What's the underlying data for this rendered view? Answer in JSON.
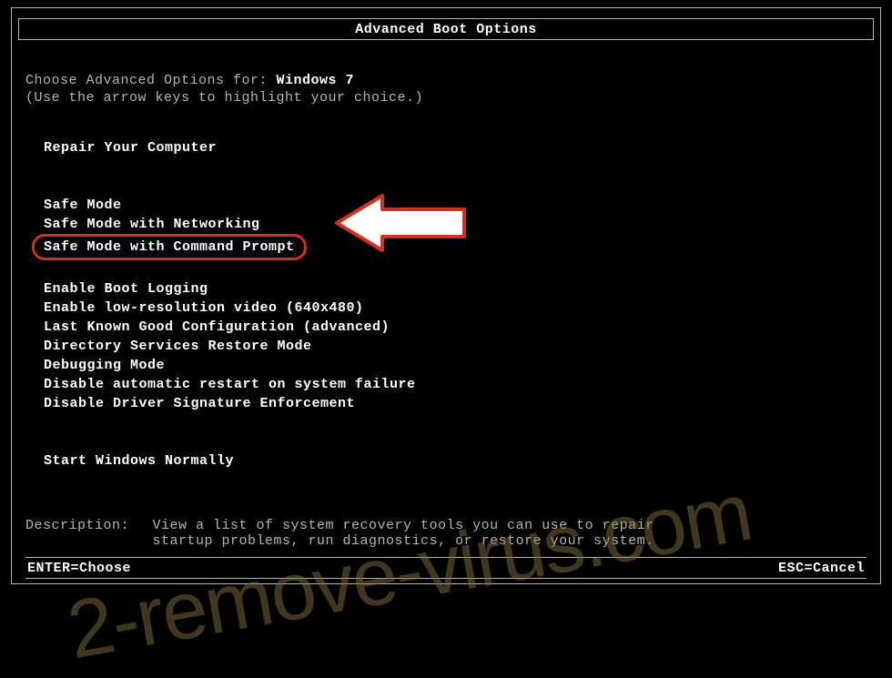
{
  "title": "Advanced Boot Options",
  "choose_prefix": "Choose Advanced Options for: ",
  "os_name": "Windows 7",
  "hint": "(Use the arrow keys to highlight your choice.)",
  "menu": {
    "repair": "Repair Your Computer",
    "safe_mode": "Safe Mode",
    "safe_mode_net": "Safe Mode with Networking",
    "safe_mode_cmd": "Safe Mode with Command Prompt",
    "boot_logging": "Enable Boot Logging",
    "low_res": "Enable low-resolution video (640x480)",
    "last_known": "Last Known Good Configuration (advanced)",
    "ds_restore": "Directory Services Restore Mode",
    "debugging": "Debugging Mode",
    "disable_restart": "Disable automatic restart on system failure",
    "disable_driver_sig": "Disable Driver Signature Enforcement",
    "start_normal": "Start Windows Normally"
  },
  "description": {
    "label": "Description:",
    "text": "View a list of system recovery tools you can use to repair startup problems, run diagnostics, or restore your system."
  },
  "footer": {
    "enter": "ENTER=Choose",
    "esc": "ESC=Cancel"
  },
  "watermark": "2-remove-virus.com"
}
